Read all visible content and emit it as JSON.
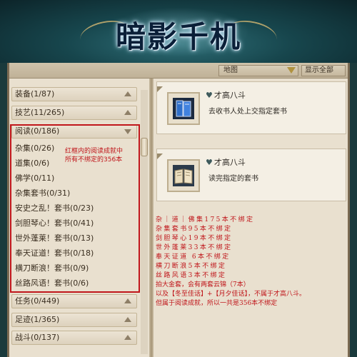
{
  "banner": {
    "title": "暗影千机"
  },
  "toolbar": {
    "map_label": "地图",
    "show_all_label": "显示全部"
  },
  "categories": [
    {
      "label": "装备(1/87)"
    },
    {
      "label": "技艺(11/265)"
    },
    {
      "label": "阅读(0/186)"
    },
    {
      "label": "任务(0/449)"
    },
    {
      "label": "足迹(1/365)"
    },
    {
      "label": "战斗(0/137)"
    }
  ],
  "reading_items": [
    "杂集(0/26)",
    "道集(0/6)",
    "佛学(0/11)",
    "杂集套书(0/31)",
    "安史之乱！套书(0/23)",
    "剑胆琴心！套书(0/41)",
    "世外蓬莱！套书(0/13)",
    "奉天证道！套书(0/18)",
    "横刀断浪！套书(0/9)",
    "丝路风语！套书(0/6)"
  ],
  "annotation_left": [
    "红框内的阅读成就中",
    "所有不绑定的356本"
  ],
  "cards": [
    {
      "title": "才高八斗",
      "desc": "去收书人处上交指定套书",
      "icon": "book-set-icon"
    },
    {
      "title": "才高八斗",
      "desc": "读完指定的套书",
      "icon": "open-book-icon"
    }
  ],
  "notes": [
    "杂｜道｜佛集175本不绑定",
    "杂集套书95本不绑定",
    "剑胆琴心19本不绑定",
    "世外蓬莱33本不绑定",
    "奉天证道 6本不绑定",
    "横刀断浪5本不绑定",
    "丝路风语3本不绑定",
    "拍大金套，会有两套云锦（7本）",
    "以及【冬至佳话】+【月夕佳话】，不属于才高八斗。",
    "但属于阅读成就，所以一共是356本不绑定"
  ],
  "colors": {
    "annotation_red": "#c0161b",
    "panel_bg": "#e9e0cf"
  }
}
